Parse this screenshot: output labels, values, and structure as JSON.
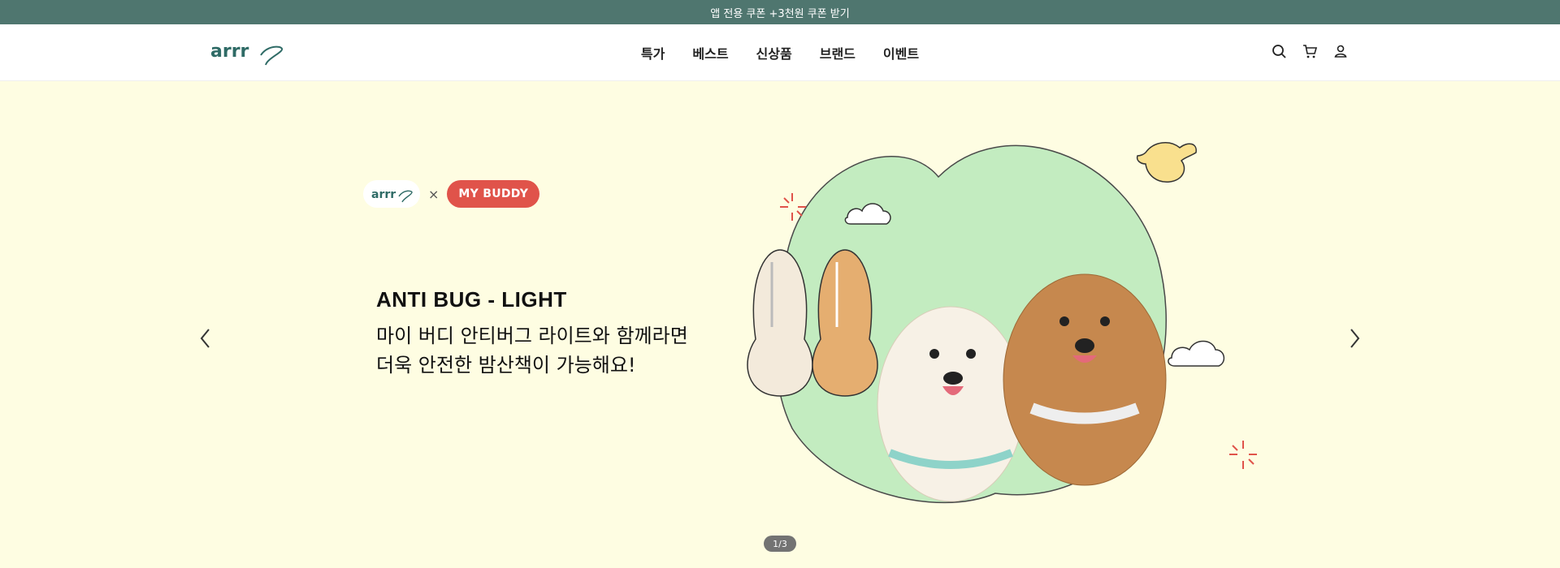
{
  "topbar": {
    "text": "앱 전용 쿠폰 +3천원 쿠폰 받기"
  },
  "header": {
    "logo_text": "arrr",
    "nav": [
      "특가",
      "베스트",
      "신상품",
      "브랜드",
      "이벤트"
    ]
  },
  "hero": {
    "collab_brand": "MY BUDDY",
    "collab_separator": "×",
    "headline": "ANTI BUG - LIGHT",
    "desc_line1": "마이 버디 안티버그 라이트와 함께라면",
    "desc_line2": "더욱 안전한 밤산책이 가능해요!",
    "pager": "1/3"
  },
  "colors": {
    "topbar": "#4f766f",
    "hero_bg": "#fefde2",
    "buddy": "#e0534a",
    "accent": "#2f6b66",
    "blob": "#c3ecc0"
  },
  "icons": {
    "search": "search-icon",
    "cart": "cart-icon",
    "user": "user-icon",
    "prev": "chevron-left-icon",
    "next": "chevron-right-icon"
  }
}
